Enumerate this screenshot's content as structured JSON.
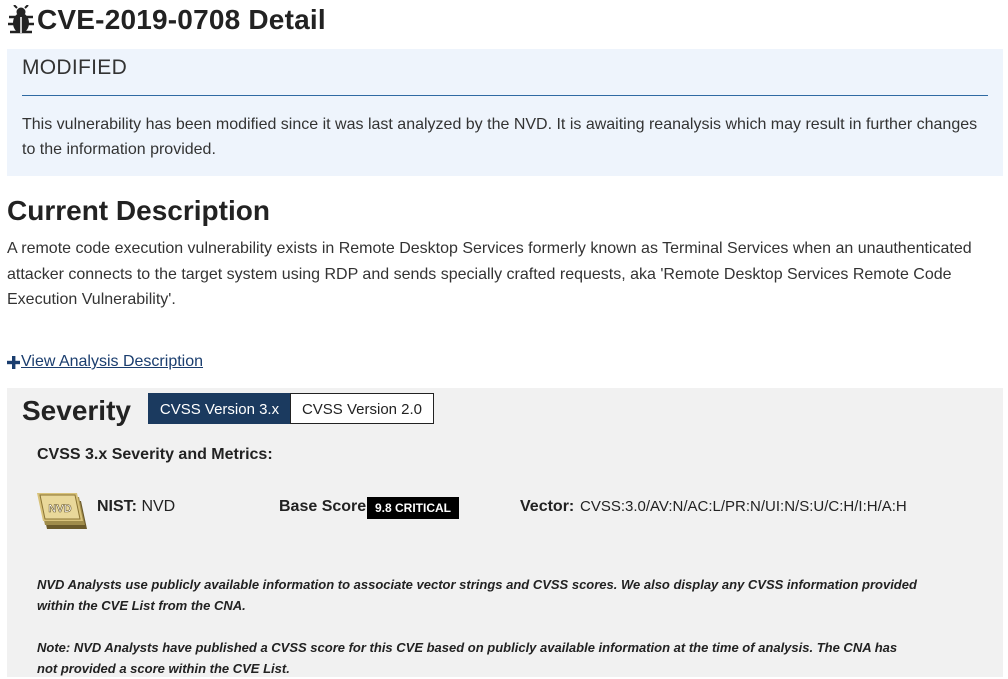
{
  "header": {
    "title": "CVE-2019-0708 Detail",
    "icon": "bug-icon"
  },
  "modified_notice": {
    "heading": "MODIFIED",
    "text": "This vulnerability has been modified since it was last analyzed by the NVD. It is awaiting reanalysis which may result in further changes to the information provided."
  },
  "description": {
    "heading": "Current Description",
    "text": "A remote code execution vulnerability exists in Remote Desktop Services formerly known as Terminal Services when an unauthenticated attacker connects to the target system using RDP and sends specially crafted requests, aka 'Remote Desktop Services Remote Code Execution Vulnerability'.",
    "analysis_link": "View Analysis Description"
  },
  "severity": {
    "heading": "Severity",
    "tabs": [
      {
        "label": "CVSS Version 3.x",
        "active": true
      },
      {
        "label": "CVSS Version 2.0",
        "active": false
      }
    ],
    "metrics_heading": "CVSS 3.x Severity and Metrics:",
    "logo_text": "NVD",
    "nist_label": "NIST:",
    "nist_value": "NVD",
    "base_score_label": "Base Score:",
    "base_score": "9.8 CRITICAL",
    "vector_label": "Vector:",
    "vector_value": "CVSS:3.0/AV:N/AC:L/PR:N/UI:N/S:U/C:H/I:H/A:H",
    "note_1": "NVD Analysts use publicly available information to associate vector strings and CVSS scores. We also display any CVSS information provided within the CVE List from the CNA.",
    "note_2": "Note: NVD Analysts have published a CVSS score for this CVE based on publicly available information at the time of analysis. The CNA has not provided a score within the CVE List."
  },
  "colors": {
    "modified_bg": "#eef4fc",
    "rule": "#2f6aa3",
    "severity_bg": "#f1f1f1",
    "active_tab": "#1b3a5f",
    "link": "#1a3d6e",
    "badge_critical": "#000000"
  }
}
